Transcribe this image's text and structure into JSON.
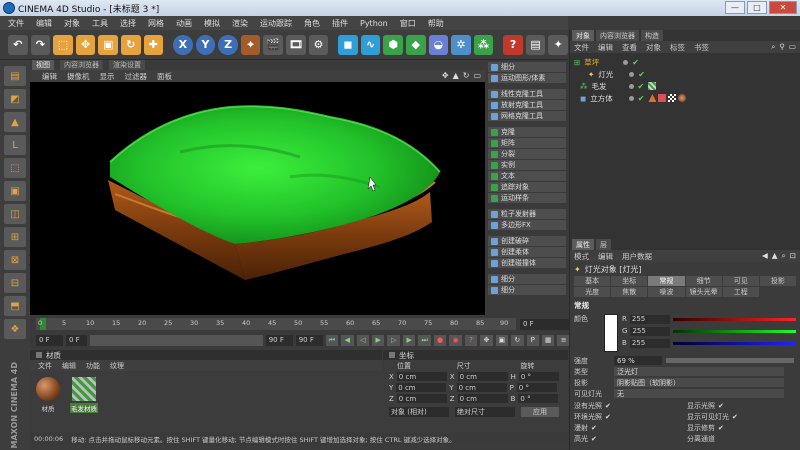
{
  "window": {
    "title": "CINEMA 4D Studio - [未标题 3 *]",
    "buttons": [
      "—",
      "□",
      "✕"
    ]
  },
  "menubar": [
    "文件",
    "编辑",
    "对象",
    "工具",
    "选择",
    "网格",
    "动画",
    "模拟",
    "渲染",
    "运动跟踪",
    "角色",
    "插件",
    "Python",
    "窗口",
    "帮助"
  ],
  "viewport": {
    "tabs": [
      "视图",
      "内容浏览器",
      "渲染设置"
    ],
    "menu": [
      "编辑",
      "摄像机",
      "显示",
      "过滤器",
      "面板"
    ]
  },
  "object_toolbar": [
    "细分",
    "运动图形/体素",
    "线性克隆工具",
    "放射克隆工具",
    "网格克隆工具",
    "克隆",
    "矩阵",
    "分裂",
    "实例",
    "文本",
    "追踪对象",
    "运动样条",
    "粒子发射器",
    "多边形FX",
    "创建破碎",
    "创建柔体",
    "创建碰撞体",
    "细分",
    "细分"
  ],
  "timeline": {
    "ticks": [
      "0",
      "5",
      "10",
      "15",
      "20",
      "25",
      "30",
      "35",
      "40",
      "45",
      "50",
      "55",
      "60",
      "65",
      "70",
      "75",
      "80",
      "85",
      "90"
    ],
    "frame": "0 F",
    "start": "0 F",
    "end": "90 F",
    "current": "90 F"
  },
  "materials": {
    "title": "材质",
    "menu": [
      "文件",
      "编辑",
      "功能",
      "纹理"
    ],
    "items": [
      {
        "name": "材质"
      },
      {
        "name": "毛发材质"
      }
    ]
  },
  "coords": {
    "title": "坐标",
    "headers": [
      "位置",
      "尺寸",
      "旋转"
    ],
    "rows": [
      {
        "pos_label": "X",
        "pos": "0 cm",
        "size_label": "X",
        "size": "0 cm",
        "rot_label": "H",
        "rot": "0 °"
      },
      {
        "pos_label": "Y",
        "pos": "0 cm",
        "size_label": "Y",
        "size": "0 cm",
        "rot_label": "P",
        "rot": "0 °"
      },
      {
        "pos_label": "Z",
        "pos": "0 cm",
        "size_label": "Z",
        "size": "0 cm",
        "rot_label": "B",
        "rot": "0 °"
      }
    ],
    "mode": "对象 (相对)",
    "size_mode": "绝对尺寸",
    "apply": "应用"
  },
  "status": {
    "time": "00:00:06",
    "text": "移动: 点击并拖动鼠标移动元素。按住 SHIFT 键量化移动; 节点编辑模式时按住 SHIFT 键增加选择对象; 按住 CTRL 键减少选择对象。"
  },
  "maxon_logo": "MAXON CINEMA 4D",
  "right_panel": {
    "tabs": [
      "对象",
      "内容浏览器",
      "构造"
    ],
    "menu": [
      "文件",
      "编辑",
      "查看",
      "对象",
      "标签",
      "书签"
    ],
    "tree": [
      {
        "name": "草坪",
        "sel": true
      },
      {
        "name": "灯光",
        "sel": false
      },
      {
        "name": "毛发",
        "sel": false
      },
      {
        "name": "立方体",
        "sel": false
      }
    ],
    "attr_tabs_top": [
      "属性",
      "层"
    ],
    "attr_menu": [
      "模式",
      "编辑",
      "用户数据"
    ],
    "object_title": "灯光对象 [灯光]",
    "attr_tabs": [
      "基本",
      "坐标",
      "常规",
      "细节",
      "可见",
      "投影",
      "光度",
      "焦散",
      "噪波",
      "镜头光晕",
      "工程"
    ],
    "active_tab": "常规",
    "section": "常规",
    "color_label": "颜色",
    "rgb": [
      {
        "k": "R",
        "v": "255"
      },
      {
        "k": "G",
        "v": "255"
      },
      {
        "k": "B",
        "v": "255"
      }
    ],
    "props": [
      {
        "k": "强度",
        "v": "69 %"
      },
      {
        "k": "类型",
        "v": "泛光灯"
      },
      {
        "k": "投影",
        "v": "阴影贴图（软阴影）"
      },
      {
        "k": "可见灯光",
        "v": "无"
      }
    ],
    "checks": [
      {
        "k": "没有光照",
        "v": "显示光照",
        "c": true
      },
      {
        "k": "环境光照",
        "v": "显示可见灯光",
        "c": true
      },
      {
        "k": "漫射",
        "v": "显示修剪",
        "c": true
      },
      {
        "k": "高光",
        "v": "分离通道",
        "c": false
      }
    ]
  },
  "colors": {
    "accent": "#e6a23c",
    "grass": "#22c12a",
    "dirt": "#8a4512"
  }
}
